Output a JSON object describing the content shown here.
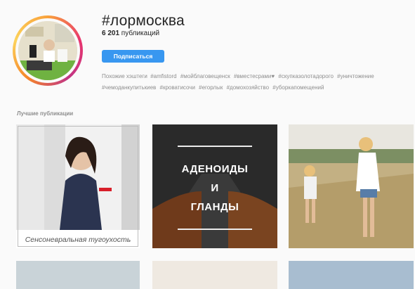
{
  "header": {
    "hashtag": "#лормосква",
    "count": "6 201",
    "count_suffix": " публикаций",
    "subscribe_label": "Подписаться"
  },
  "related": {
    "label": "Похожие хэштеги",
    "tags": [
      "#amfistord",
      "#мойблаговещенск",
      "#вместесрами♥",
      "#скупказолотадорого",
      "#уничтожение",
      "#чемоданкупитькиев",
      "#кроватисочи",
      "#егорлык",
      "#домохозяйство",
      "#уборкапомещений"
    ]
  },
  "section": {
    "title": "Лучшие публикации"
  },
  "posts": [
    {
      "caption": "Сенсоневральная тугоухость"
    },
    {
      "text_line1": "АДЕНОИДЫ",
      "text_line2": "И",
      "text_line3": "ГЛАНДЫ"
    }
  ]
}
